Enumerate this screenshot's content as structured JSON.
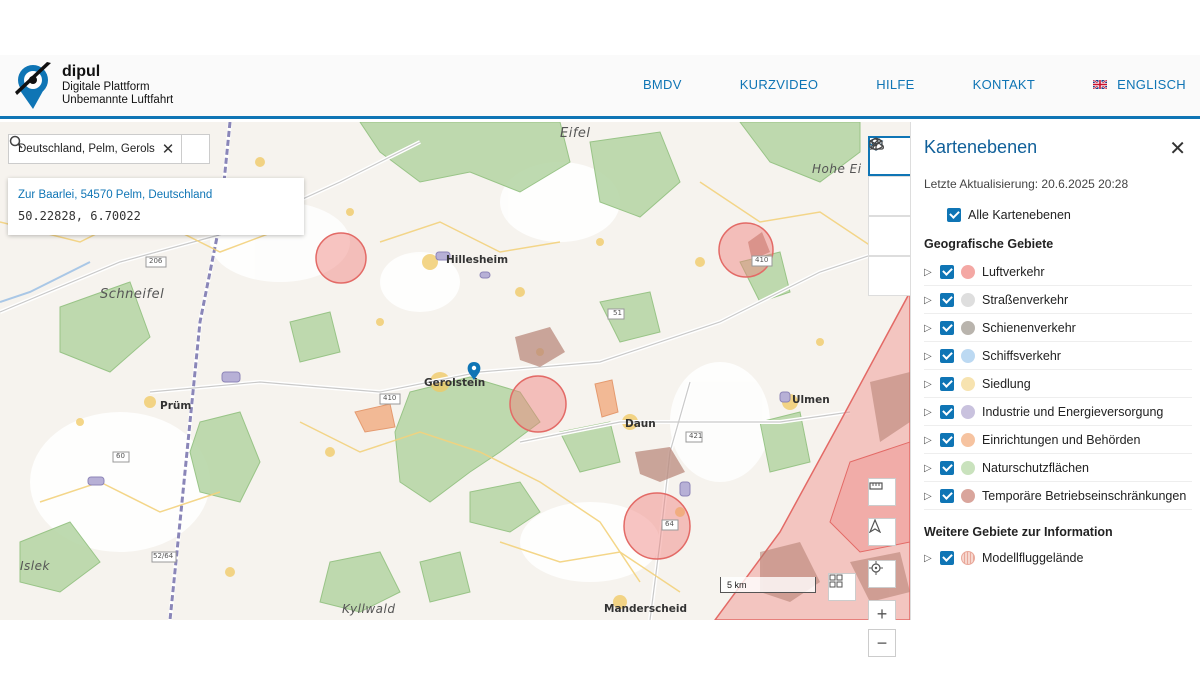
{
  "brand": {
    "name": "dipul",
    "line1": "Digitale Plattform",
    "line2": "Unbemannte Luftfahrt"
  },
  "nav": {
    "items": [
      "BMDV",
      "KURZVIDEO",
      "HILFE",
      "KONTAKT"
    ],
    "language": "ENGLISCH"
  },
  "search": {
    "value": "Deutschland, Pelm, Gerols"
  },
  "result": {
    "address": "Zur Baarlei, 54570 Pelm, Deutschland",
    "coords": "50.22828, 6.70022"
  },
  "map": {
    "region_labels": [
      "Eifel",
      "Hohe Ei",
      "Schneifel",
      "Islek",
      "Kyllwald"
    ],
    "towns": [
      "Hillesheim",
      "Gerolstein",
      "Prüm",
      "Daun",
      "Ulmen",
      "Manderscheid"
    ],
    "roads": [
      "206",
      "410",
      "410",
      "410",
      "410",
      "60",
      "51",
      "421",
      "52/64",
      "64"
    ],
    "scale": "5 km",
    "zoom_in": "+",
    "zoom_out": "−"
  },
  "panel": {
    "title": "Kartenebenen",
    "updated": "Letzte Aktualisierung: 20.6.2025 20:28",
    "all_layers": "Alle Kartenebenen",
    "section1": "Geografische Gebiete",
    "layers": [
      {
        "label": "Luftverkehr",
        "color": "#f4a8a4"
      },
      {
        "label": "Straßenverkehr",
        "color": "#dedede"
      },
      {
        "label": "Schienenverkehr",
        "color": "#b9b4ad"
      },
      {
        "label": "Schiffsverkehr",
        "color": "#bcd9f2"
      },
      {
        "label": "Siedlung",
        "color": "#f7e3b0"
      },
      {
        "label": "Industrie und Energieversorgung",
        "color": "#c9c2de"
      },
      {
        "label": "Einrichtungen und Behörden",
        "color": "#f6c3a0"
      },
      {
        "label": "Naturschutzflächen",
        "color": "#c9e2bd"
      },
      {
        "label": "Temporäre Betriebseinschränkungen",
        "color": "#d9a59c"
      }
    ],
    "section2": "Weitere Gebiete zur Information",
    "info_layers": [
      {
        "label": "Modellfluggelände",
        "color": "#f6d7cf"
      }
    ]
  },
  "colors": {
    "accent": "#0f75b5"
  }
}
